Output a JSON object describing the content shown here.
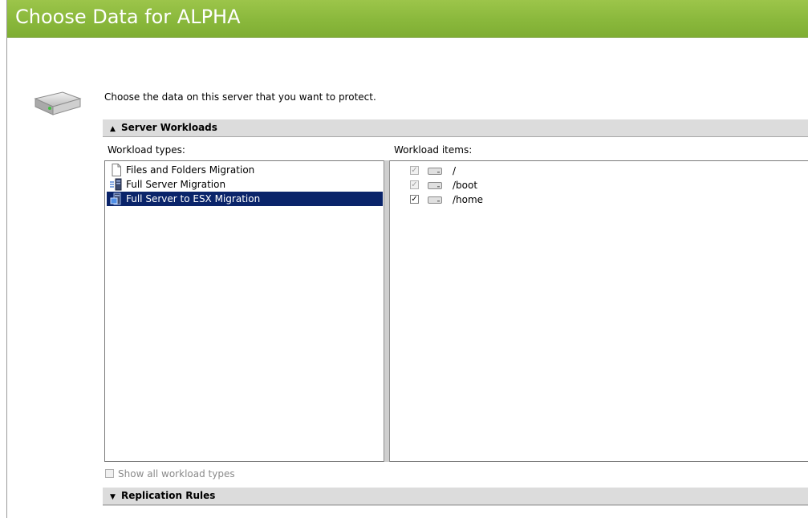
{
  "window": {
    "title": "Choose Data for ALPHA"
  },
  "intro": {
    "text": "Choose the data on this server that you want to protect."
  },
  "sections": {
    "server_workloads": {
      "label": "Server Workloads",
      "state": "expanded"
    },
    "replication_rules": {
      "label": "Replication Rules",
      "state": "collapsed"
    }
  },
  "workload_types": {
    "label": "Workload types:",
    "items": [
      {
        "label": "Files and Folders Migration",
        "icon": "document-icon",
        "selected": false
      },
      {
        "label": "Full Server Migration",
        "icon": "server-migration-icon",
        "selected": false
      },
      {
        "label": "Full Server to ESX Migration",
        "icon": "esx-migration-icon",
        "selected": true
      }
    ]
  },
  "workload_items": {
    "label": "Workload items:",
    "items": [
      {
        "label": "/",
        "checked": true,
        "disabled": true,
        "icon": "disk-icon"
      },
      {
        "label": "/boot",
        "checked": true,
        "disabled": true,
        "icon": "disk-icon"
      },
      {
        "label": "/home",
        "checked": true,
        "disabled": false,
        "icon": "disk-icon"
      }
    ]
  },
  "show_all": {
    "label": "Show all workload types",
    "checked": false,
    "disabled": true
  },
  "colors": {
    "title_bar": "#8ab83c",
    "selection": "#0a246a",
    "section_header": "#dcdcdc"
  }
}
